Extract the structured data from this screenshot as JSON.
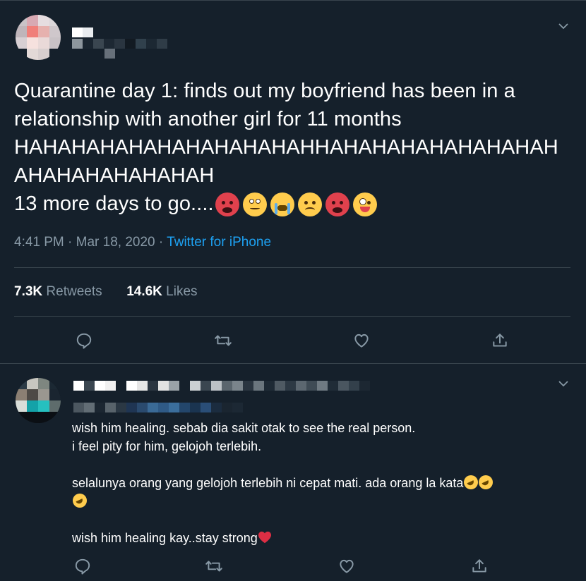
{
  "tweet": {
    "text": "Quarantine day 1: finds out my boyfriend has been in a relationship with another girl for 11 months HAHAHAHAHAHAHAHAHAHAHHAHAHAHAHAHAHAHAH AHAHAHAHAHAHAH\n13 more days to go....",
    "emojis": [
      "pouting-face-emoji",
      "face-with-rolling-eyes-emoji",
      "loudly-crying-face-emoji",
      "slightly-frowning-face-emoji",
      "pouting-face-emoji",
      "zany-face-emoji"
    ],
    "time": "4:41 PM",
    "date": "Mar 18, 2020",
    "source": "Twitter for iPhone",
    "retweets_count": "7.3K",
    "retweets_label": "Retweets",
    "likes_count": "14.6K",
    "likes_label": "Likes",
    "actions": [
      "reply-icon",
      "retweet-icon",
      "like-icon",
      "share-icon"
    ]
  },
  "reply": {
    "line1": "wish him healing. sebab dia sakit otak to see the real person.",
    "line2": "i feel pity for him, gelojoh terlebih.",
    "line3": "selalunya orang yang gelojoh terlebih ni cepat mati. ada orang la kata",
    "line4": "wish him healing kay..stay strong",
    "emojis": [
      "rolling-on-floor-laughing-emoji",
      "red-heart-emoji"
    ],
    "actions": [
      "reply-icon",
      "retweet-icon",
      "like-icon",
      "share-icon"
    ]
  },
  "colors": {
    "background": "#15202b",
    "secondary_text": "#8899a6",
    "link": "#1da1f2",
    "divider": "#38444d"
  }
}
